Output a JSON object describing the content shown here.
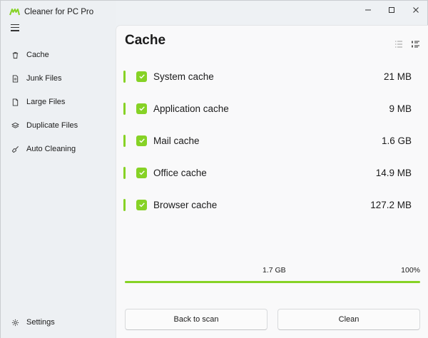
{
  "app": {
    "title": "Cleaner for PC Pro"
  },
  "sidebar": {
    "items": [
      {
        "label": "Cache",
        "icon": "trash-icon"
      },
      {
        "label": "Junk Files",
        "icon": "document-icon"
      },
      {
        "label": "Large Files",
        "icon": "file-icon"
      },
      {
        "label": "Duplicate Files",
        "icon": "layers-icon"
      },
      {
        "label": "Auto Cleaning",
        "icon": "broom-icon"
      }
    ],
    "settings": {
      "label": "Settings",
      "icon": "gear-icon"
    }
  },
  "main": {
    "title": "Cache",
    "items": [
      {
        "label": "System cache",
        "size": "21 MB",
        "checked": true
      },
      {
        "label": "Application cache",
        "size": "9 MB",
        "checked": true
      },
      {
        "label": "Mail cache",
        "size": "1.6 GB",
        "checked": true
      },
      {
        "label": "Office cache",
        "size": "14.9 MB",
        "checked": true
      },
      {
        "label": "Browser cache",
        "size": "127.2 MB",
        "checked": true
      }
    ],
    "progress": {
      "total": "1.7 GB",
      "percent_label": "100%",
      "value": 1.0
    },
    "buttons": {
      "back": "Back to scan",
      "clean": "Clean"
    }
  },
  "colors": {
    "accent": "#86d225",
    "background": "#eef1f4",
    "panel": "#f9f9fa"
  }
}
